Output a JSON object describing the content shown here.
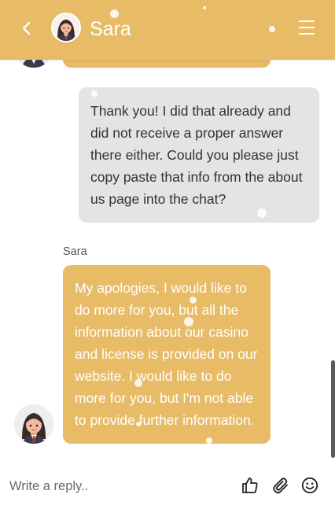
{
  "header": {
    "contact_name": "Sara",
    "back_icon": "chevron-left-icon",
    "menu_icon": "hamburger-menu-icon",
    "background_color": "#e8bb66"
  },
  "messages": [
    {
      "from": "user",
      "text": "Thank you! I did that already and did not receive a proper answer there either. Could you please just copy paste that info from the about us page into the chat?",
      "bubble_color": "#e4e4e4"
    },
    {
      "from": "agent",
      "sender_label": "Sara",
      "text": "My apologies, I would like to do more for you, but all the information about our casino and license is provided on our website. I would like to do more for you, but I'm not able to provide further information.",
      "bubble_color": "#e8bb66"
    }
  ],
  "composer": {
    "placeholder": "Write a reply..",
    "value": "",
    "icons": [
      "thumbs-up-icon",
      "paperclip-icon",
      "smiley-icon"
    ]
  }
}
